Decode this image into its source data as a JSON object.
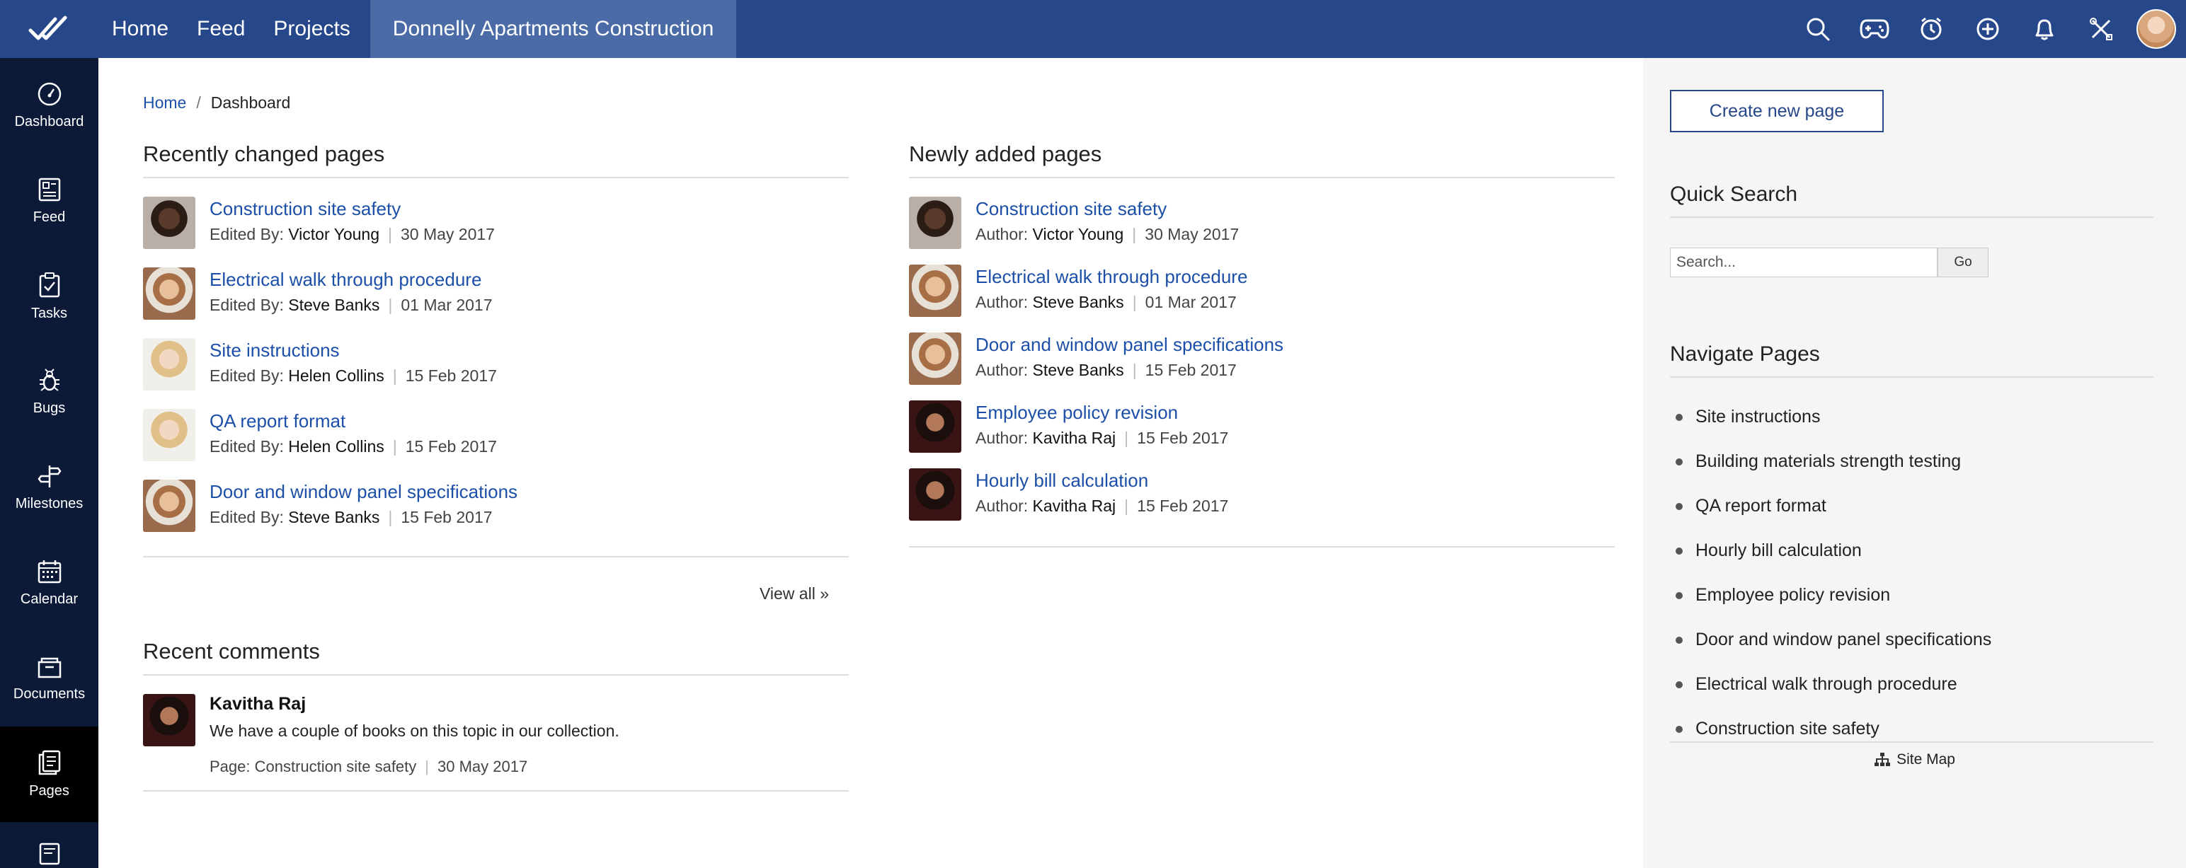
{
  "topbar": {
    "nav": [
      "Home",
      "Feed",
      "Projects"
    ],
    "active_project": "Donnelly Apartments Construction",
    "icons": [
      "search-icon",
      "gamepad-icon",
      "clock-icon",
      "plus-circle-icon",
      "bell-icon",
      "tools-icon"
    ]
  },
  "sidebar": {
    "items": [
      {
        "label": "Dashboard",
        "icon": "gauge-icon"
      },
      {
        "label": "Feed",
        "icon": "feed-icon"
      },
      {
        "label": "Tasks",
        "icon": "clipboard-icon"
      },
      {
        "label": "Bugs",
        "icon": "bug-icon"
      },
      {
        "label": "Milestones",
        "icon": "signpost-icon"
      },
      {
        "label": "Calendar",
        "icon": "calendar-icon"
      },
      {
        "label": "Documents",
        "icon": "folder-icon"
      },
      {
        "label": "Pages",
        "icon": "pages-icon"
      }
    ]
  },
  "breadcrumb": {
    "home": "Home",
    "sep": "/",
    "current": "Dashboard"
  },
  "recently_changed": {
    "title": "Recently changed pages",
    "label": "Edited By:",
    "items": [
      {
        "title": "Construction site safety",
        "name": "Victor Young",
        "date": "30 May 2017"
      },
      {
        "title": "Electrical walk through procedure",
        "name": "Steve Banks",
        "date": "01 Mar 2017"
      },
      {
        "title": "Site instructions",
        "name": "Helen Collins",
        "date": "15 Feb 2017"
      },
      {
        "title": "QA report format",
        "name": "Helen Collins",
        "date": "15 Feb 2017"
      },
      {
        "title": "Door and window panel specifications",
        "name": "Steve Banks",
        "date": "15 Feb 2017"
      }
    ],
    "view_all": "View all »"
  },
  "newly_added": {
    "title": "Newly added pages",
    "label": "Author:",
    "items": [
      {
        "title": "Construction site safety",
        "name": "Victor Young",
        "date": "30 May 2017"
      },
      {
        "title": "Electrical walk through procedure",
        "name": "Steve Banks",
        "date": "01 Mar 2017"
      },
      {
        "title": "Door and window panel specifications",
        "name": "Steve Banks",
        "date": "15 Feb 2017"
      },
      {
        "title": "Employee policy revision",
        "name": "Kavitha Raj",
        "date": "15 Feb 2017"
      },
      {
        "title": "Hourly bill calculation",
        "name": "Kavitha Raj",
        "date": "15 Feb 2017"
      }
    ]
  },
  "recent_comments": {
    "title": "Recent comments",
    "items": [
      {
        "name": "Kavitha Raj",
        "text": "We have a couple of books on this topic in our collection.",
        "page_label": "Page:",
        "page": "Construction site safety",
        "date": "30 May 2017"
      }
    ]
  },
  "right": {
    "create_button": "Create new page",
    "quick_search_title": "Quick Search",
    "search_placeholder": "Search...",
    "go": "Go",
    "navigate_title": "Navigate Pages",
    "nav_pages": [
      "Site instructions",
      "Building materials strength testing",
      "QA report format",
      "Hourly bill calculation",
      "Employee policy revision",
      "Door and window panel specifications",
      "Electrical walk through procedure",
      "Construction site safety"
    ],
    "site_map": "Site Map"
  }
}
